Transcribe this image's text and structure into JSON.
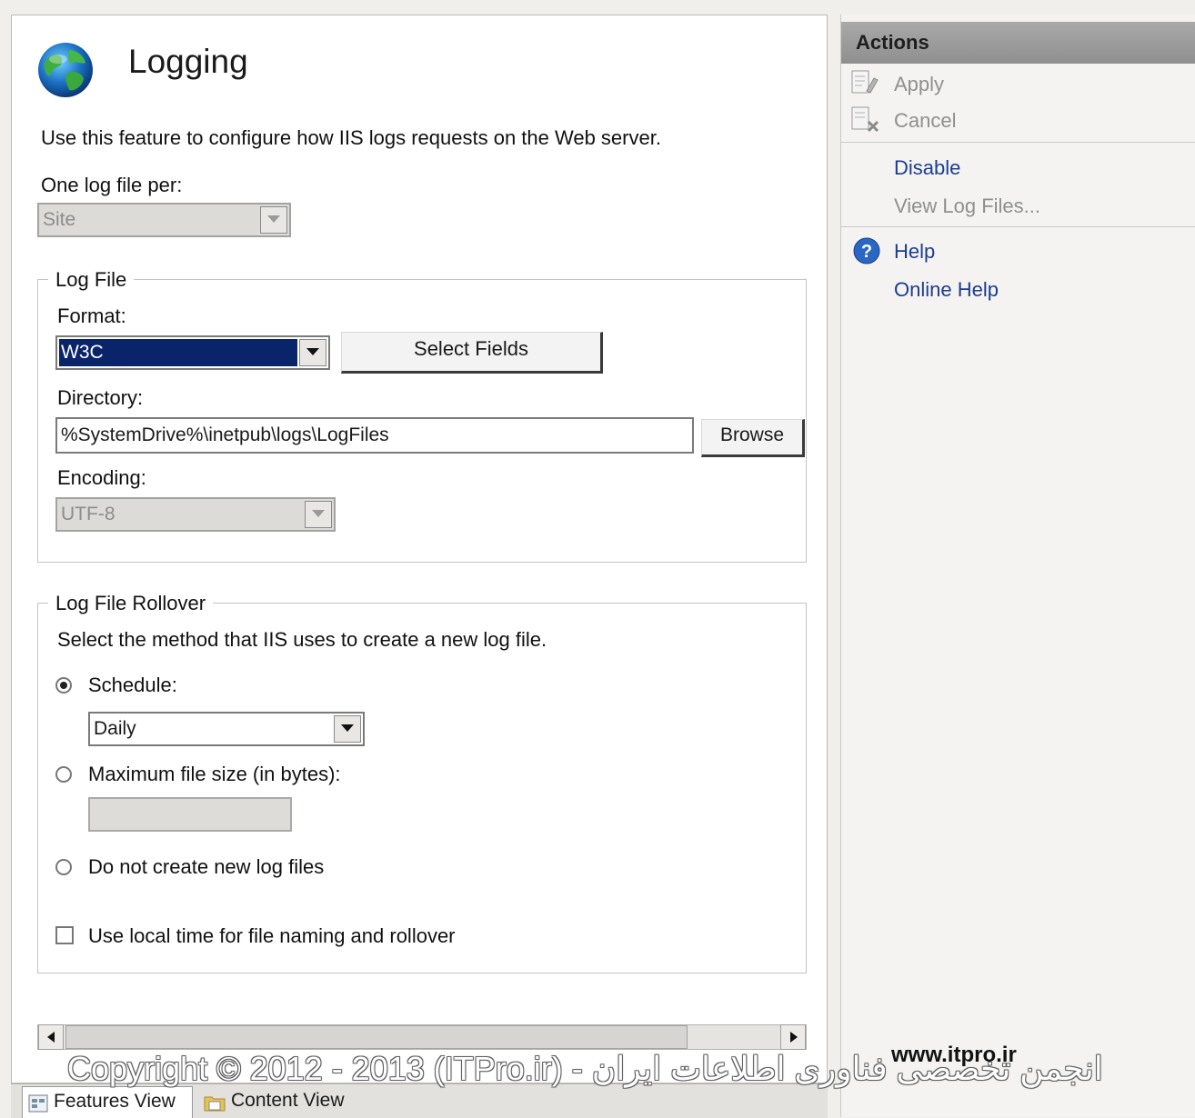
{
  "page": {
    "title": "Logging",
    "description": "Use this feature to configure how IIS logs requests on the Web server."
  },
  "one_log_file_per": {
    "label": "One log file per:",
    "value": "Site"
  },
  "log_file": {
    "group_title": "Log File",
    "format_label": "Format:",
    "format_value": "W3C",
    "select_fields_label": "Select Fields",
    "directory_label": "Directory:",
    "directory_value": "%SystemDrive%\\inetpub\\logs\\LogFiles",
    "browse_label": "Browse",
    "encoding_label": "Encoding:",
    "encoding_value": "UTF-8"
  },
  "rollover": {
    "group_title": "Log File Rollover",
    "description": "Select the method that IIS uses to create a new log file.",
    "schedule_label": "Schedule:",
    "schedule_value": "Daily",
    "max_size_label": "Maximum file size (in bytes):",
    "max_size_value": "",
    "no_new_label": "Do not create new log files",
    "local_time_label": "Use local time for file naming and rollover",
    "selected_option": "schedule",
    "local_time_checked": false
  },
  "actions": {
    "title": "Actions",
    "apply": "Apply",
    "cancel": "Cancel",
    "disable": "Disable",
    "view_log_files": "View Log Files...",
    "help": "Help",
    "online_help": "Online Help"
  },
  "tabs": {
    "features_view": "Features View",
    "content_view": "Content View"
  },
  "watermark": {
    "copyright": "Copyright © 2012 - 2013 (ITPro.ir) - انجمن تخصصی فناوری اطلاعات ایران",
    "site": "www.itpro.ir"
  },
  "colors": {
    "selection": "#0a246a",
    "link": "#1c3d8f",
    "disabled": "#8f8f8f"
  }
}
